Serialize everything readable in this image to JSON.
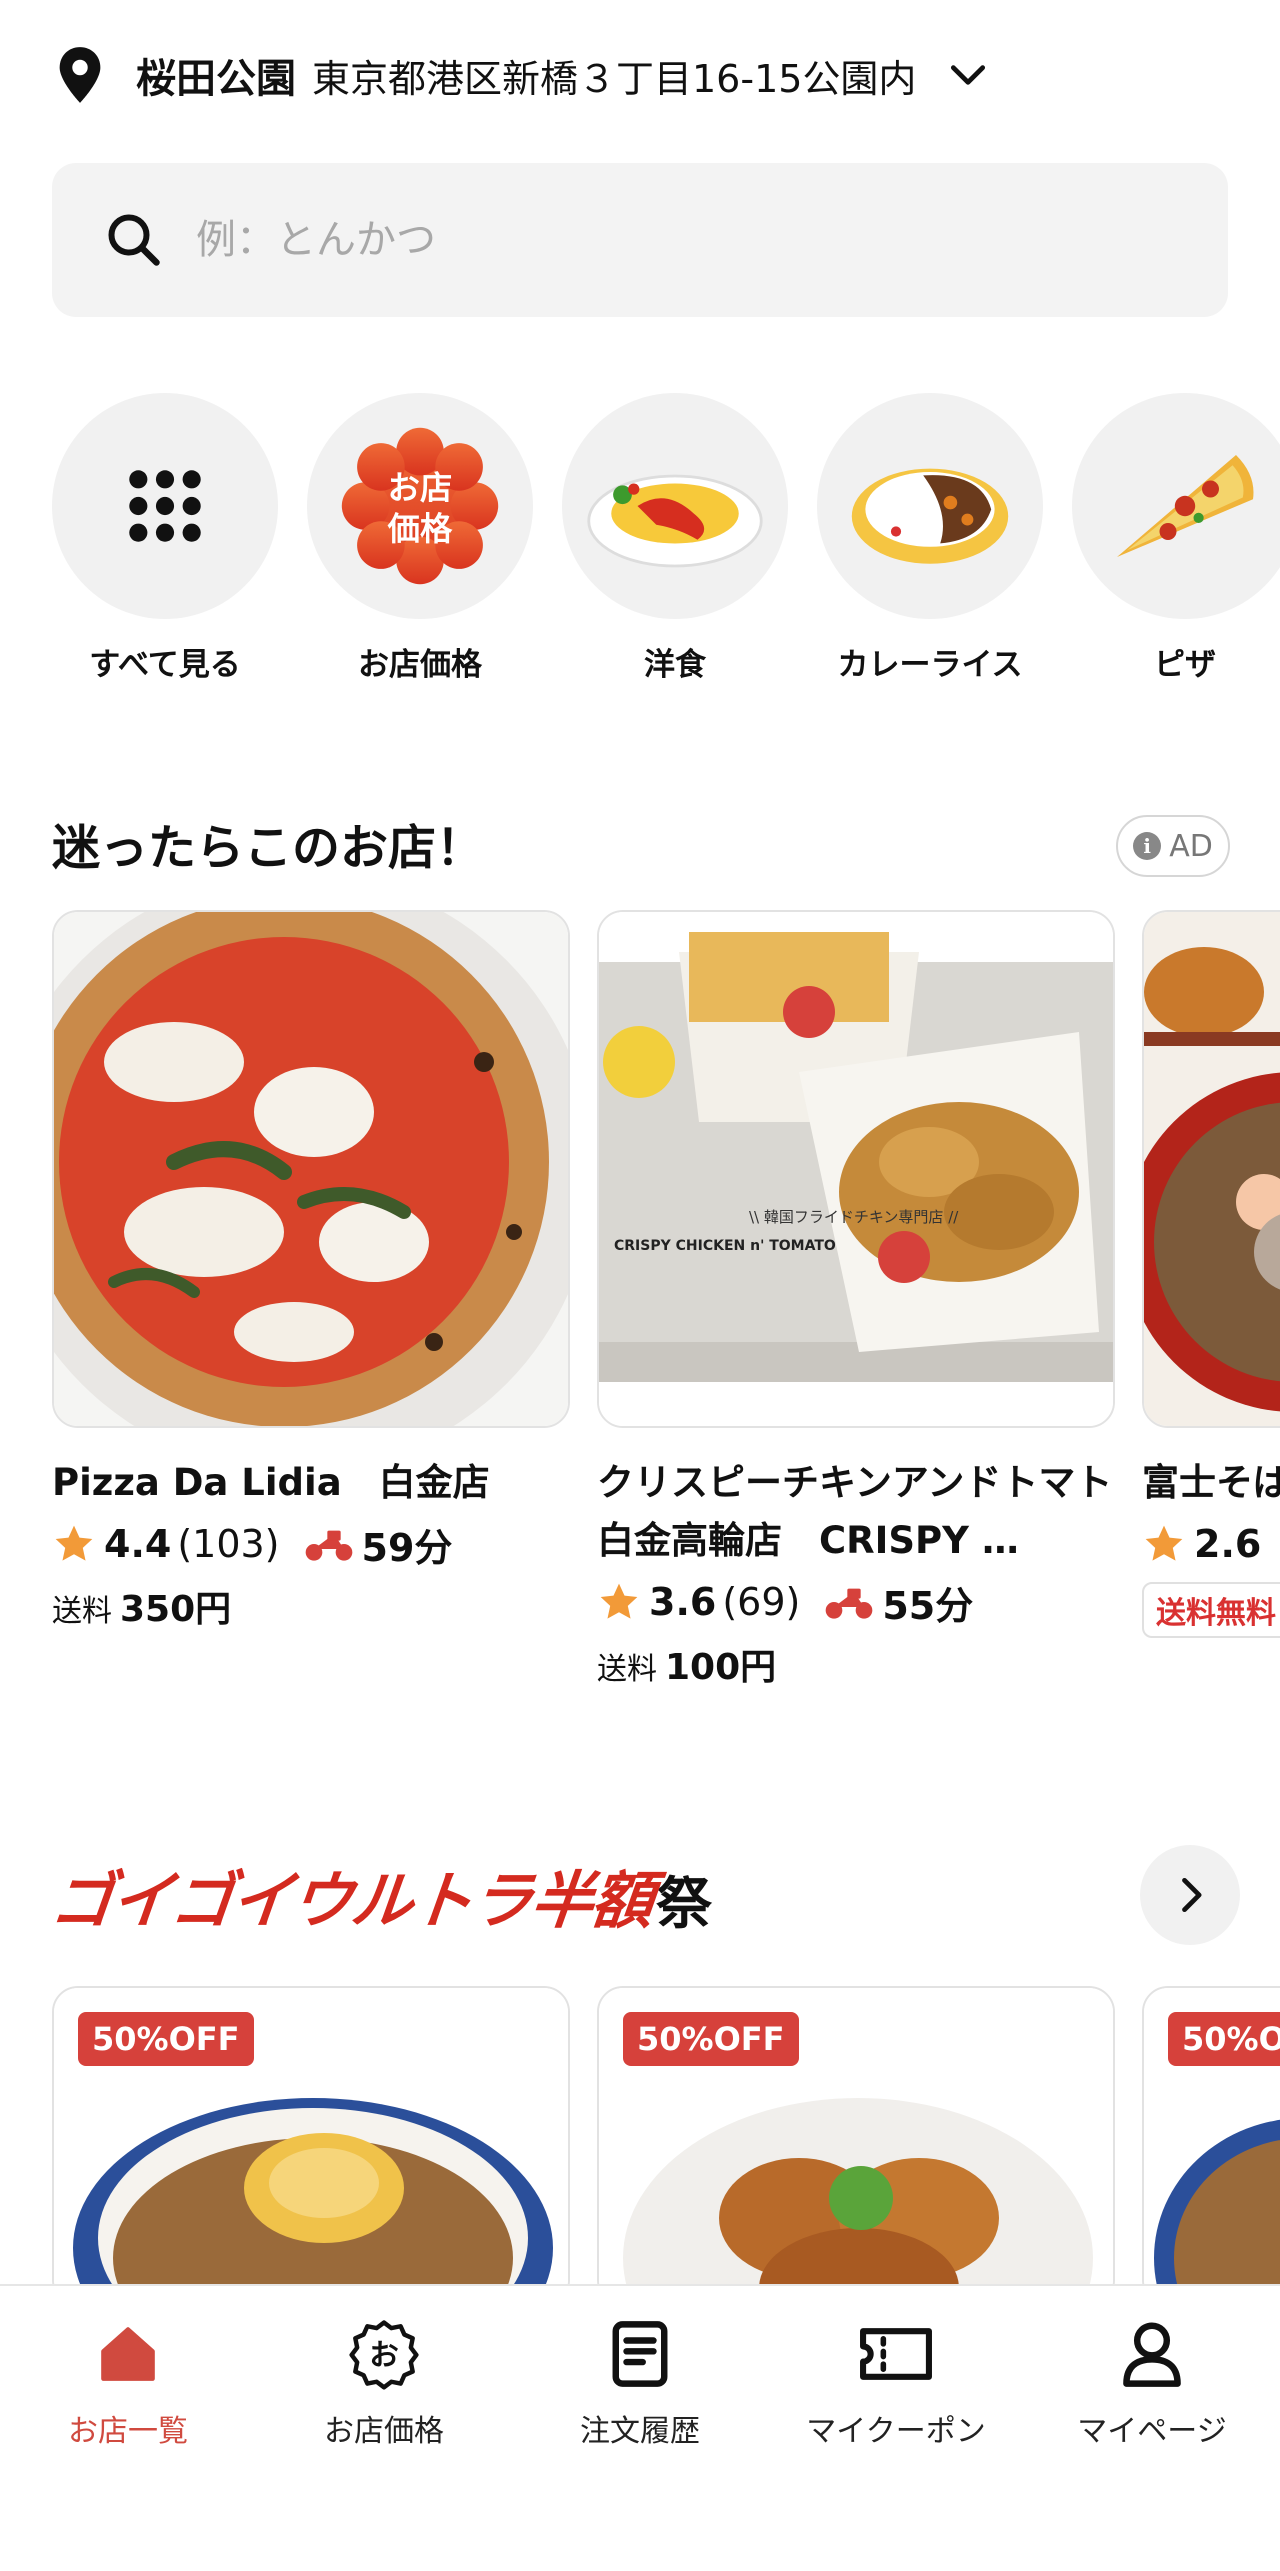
{
  "location": {
    "name": "桜田公園",
    "address": "東京都港区新橋３丁目16-15公園内"
  },
  "search": {
    "placeholder": "例：とんかつ"
  },
  "categories": [
    {
      "label": "すべて見る",
      "icon": "grid-dots-icon"
    },
    {
      "label": "お店価格",
      "icon": "store-price-badge-icon",
      "badge_text": "お店\n価格"
    },
    {
      "label": "洋食",
      "icon": "omurice-icon"
    },
    {
      "label": "カレーライス",
      "icon": "curry-rice-icon"
    },
    {
      "label": "ピザ",
      "icon": "pizza-icon"
    }
  ],
  "featured": {
    "title": "迷ったらこのお店！",
    "ad_label": "AD",
    "ad_icon": "info-icon",
    "stores": [
      {
        "name": "Pizza Da Lidia　白金店",
        "rating": "4.4",
        "reviews": "(103)",
        "time": "59分",
        "fee_label": "送料",
        "fee": "350円"
      },
      {
        "name": "クリスピーチキンアンドトマト　白金高輪店　CRISPY …",
        "rating": "3.6",
        "reviews": "(69)",
        "time": "55分",
        "fee_label": "送料",
        "fee": "100円",
        "photo_caption_1": "\\\\ 韓国フライドチキン専門店 //",
        "photo_caption_2": "CRISPY CHICKEN n' TOMATO"
      },
      {
        "name": "富士そば",
        "rating": "2.6",
        "reviews": "",
        "time": "",
        "free_label": "送料無料"
      }
    ]
  },
  "campaign": {
    "title": "ゴイゴイウルトラ半額",
    "title_suffix": "祭",
    "deal_badge": "50%OFF",
    "deal_badge_2": "50%OFF",
    "deal_badge_3": "50%O"
  },
  "nav": [
    {
      "label": "お店一覧",
      "icon": "home-icon",
      "active": true
    },
    {
      "label": "お店価格",
      "icon": "store-price-icon",
      "glyph": "お"
    },
    {
      "label": "注文履歴",
      "icon": "receipt-icon"
    },
    {
      "label": "マイクーポン",
      "icon": "coupon-icon"
    },
    {
      "label": "マイページ",
      "icon": "person-icon"
    }
  ],
  "colors": {
    "brand_red": "#d6413b",
    "star": "#f29a38",
    "active_nav": "#d04a3f"
  }
}
